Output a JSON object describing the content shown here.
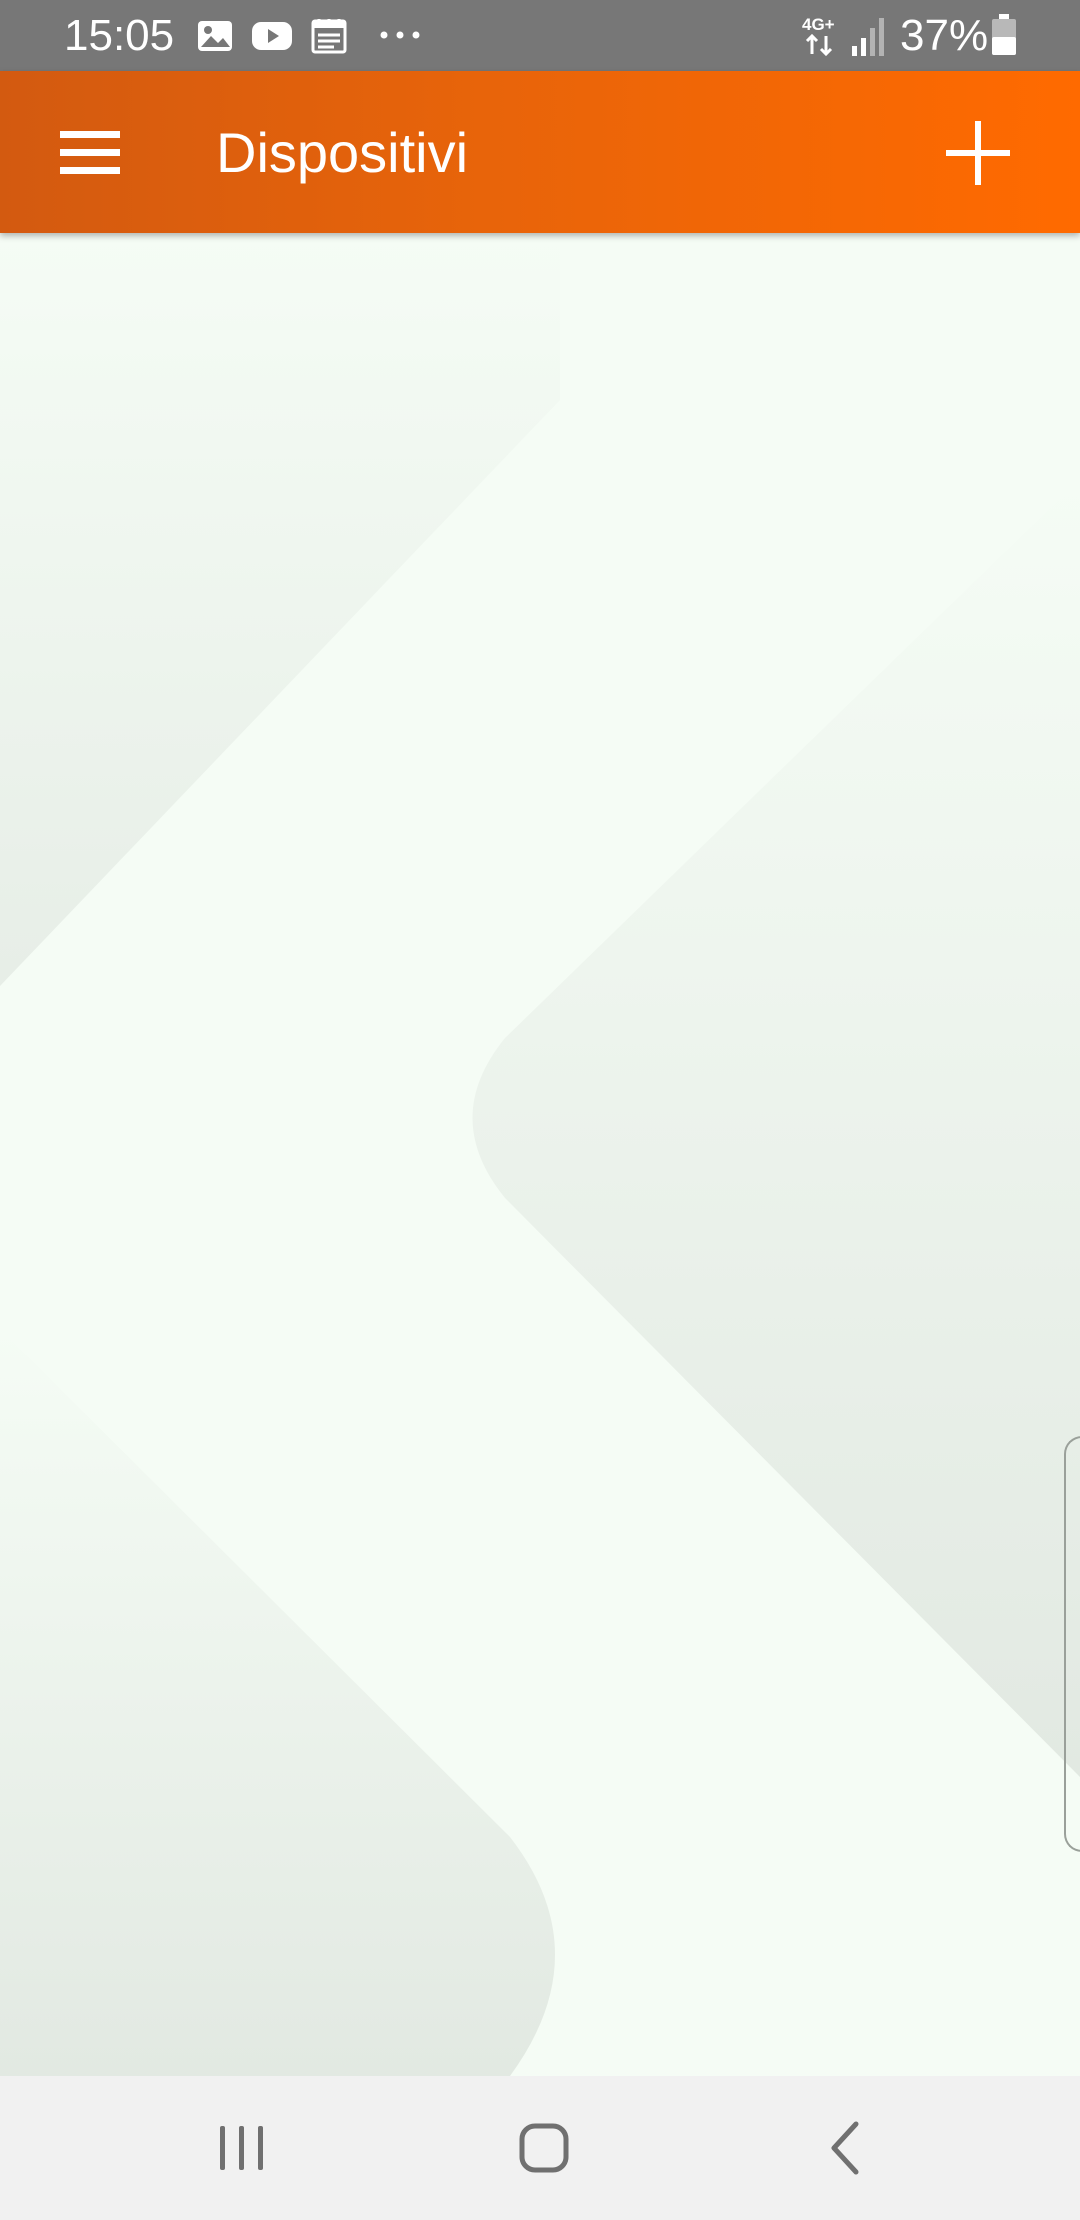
{
  "status_bar": {
    "time": "15:05",
    "notification_icons": [
      "gallery-icon",
      "youtube-icon",
      "calendar-icon",
      "more-dots-icon"
    ],
    "network_label": "4G+",
    "battery_percent": "37%",
    "background_color": "#777777"
  },
  "app_bar": {
    "title": "Dispositivi",
    "menu_icon": "hamburger-menu-icon",
    "add_icon": "plus-icon",
    "gradient_start": "#d35a10",
    "gradient_end": "#ff6a00"
  },
  "content": {
    "background_color": "#f5fcf5"
  },
  "navigation_bar": {
    "buttons": [
      "recent-apps-icon",
      "home-icon",
      "back-icon"
    ],
    "background_color": "#f1f1f1"
  }
}
